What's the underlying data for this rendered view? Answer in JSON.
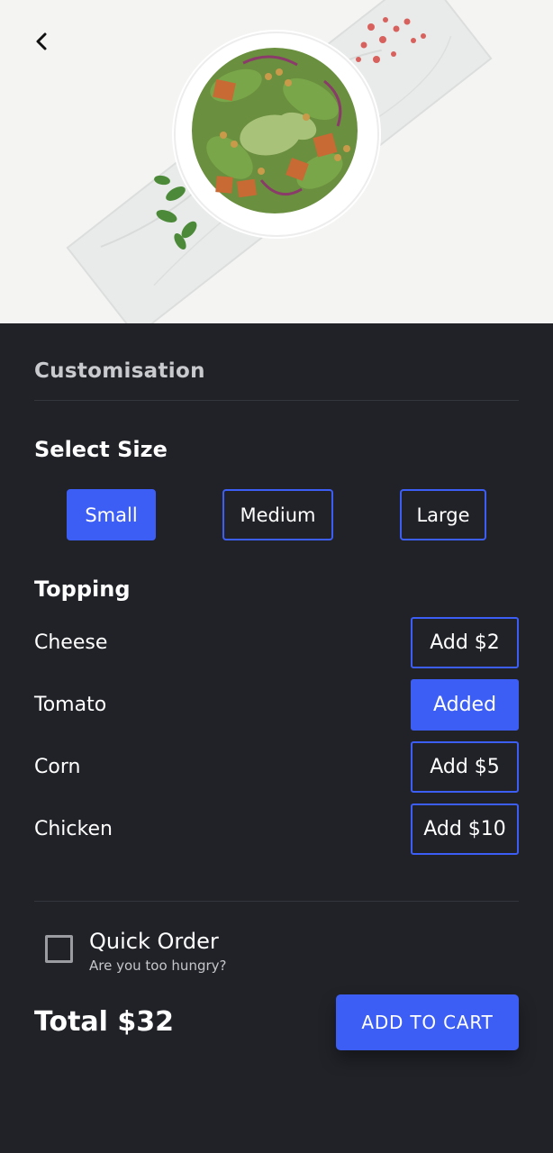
{
  "hero": {
    "back_icon": "chevron-left-icon",
    "image_subject": "salad-bowl-photo"
  },
  "customisation": {
    "title": "Customisation"
  },
  "size": {
    "heading": "Select Size",
    "options": [
      {
        "label": "Small",
        "selected": true
      },
      {
        "label": "Medium",
        "selected": false
      },
      {
        "label": "Large",
        "selected": false
      }
    ]
  },
  "topping": {
    "heading": "Topping",
    "items": [
      {
        "name": "Cheese",
        "action": "Add $2",
        "added": false
      },
      {
        "name": "Tomato",
        "action": "Added",
        "added": true
      },
      {
        "name": "Corn",
        "action": "Add $5",
        "added": false
      },
      {
        "name": "Chicken",
        "action": "Add $10",
        "added": false
      }
    ]
  },
  "quick_order": {
    "title": "Quick Order",
    "subtitle": "Are you too hungry?",
    "checked": false
  },
  "footer": {
    "total": "Total $32",
    "cart_label": "ADD TO CART"
  },
  "colors": {
    "accent": "#3d5ef5",
    "background": "#202228",
    "text": "#ffffff",
    "muted": "#c9cacd"
  }
}
